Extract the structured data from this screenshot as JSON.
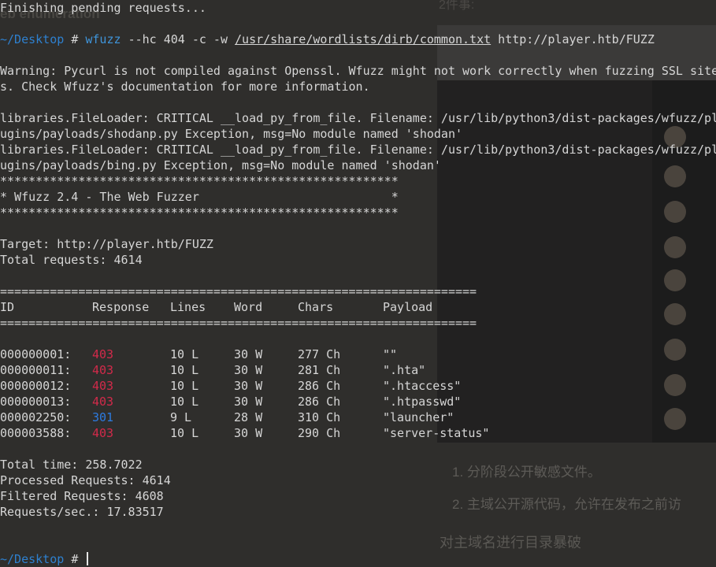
{
  "background": {
    "heading": "eb enumeration",
    "top_text": "2件事:",
    "list_items": [
      "1. 分阶段公开敏感文件。",
      "2. 主域公开源代码，允许在发布之前访"
    ],
    "bottom_text": "对主域名进行目录暴破"
  },
  "terminal": {
    "line_finishing": "Finishing pending requests...",
    "prompt_path": "~/Desktop",
    "prompt_symbol": "#",
    "command_name": "wfuzz",
    "command_args": "--hc 404 -c -w",
    "wordlist": "/usr/share/wordlists/dirb/common.txt",
    "url": "http://player.htb/FUZZ",
    "warning_1": "Warning: Pycurl is not compiled against Openssl. Wfuzz might not work correctly when fuzzing SSL site",
    "warning_2": "s. Check Wfuzz's documentation for more information.",
    "err1a": "libraries.FileLoader: CRITICAL __load_py_from_file. Filename: /usr/lib/python3/dist-packages/wfuzz/pl",
    "err1b": "ugins/payloads/shodanp.py Exception, msg=No module named 'shodan'",
    "err2a": "libraries.FileLoader: CRITICAL __load_py_from_file. Filename: /usr/lib/python3/dist-packages/wfuzz/pl",
    "err2b": "ugins/payloads/bing.py Exception, msg=No module named 'shodan'",
    "stars": "********************************************************",
    "banner": "* Wfuzz 2.4 - The Web Fuzzer                           *",
    "target": "Target: http://player.htb/FUZZ",
    "total_requests": "Total requests: 4614",
    "separator": "===================================================================",
    "headers": {
      "id": "ID",
      "response": "Response",
      "lines": "Lines",
      "word": "Word",
      "chars": "Chars",
      "payload": "Payload"
    },
    "rows": [
      {
        "id": "000000001:",
        "response": "403",
        "lines": "10 L",
        "word": "30 W",
        "chars": "277 Ch",
        "payload": "\"\""
      },
      {
        "id": "000000011:",
        "response": "403",
        "lines": "10 L",
        "word": "30 W",
        "chars": "281 Ch",
        "payload": "\".hta\""
      },
      {
        "id": "000000012:",
        "response": "403",
        "lines": "10 L",
        "word": "30 W",
        "chars": "286 Ch",
        "payload": "\".htaccess\""
      },
      {
        "id": "000000013:",
        "response": "403",
        "lines": "10 L",
        "word": "30 W",
        "chars": "286 Ch",
        "payload": "\".htpasswd\""
      },
      {
        "id": "000002250:",
        "response": "301",
        "lines": "9 L",
        "word": "28 W",
        "chars": "310 Ch",
        "payload": "\"launcher\""
      },
      {
        "id": "000003588:",
        "response": "403",
        "lines": "10 L",
        "word": "30 W",
        "chars": "290 Ch",
        "payload": "\"server-status\""
      }
    ],
    "total_time": "Total time: 258.7022",
    "processed": "Processed Requests: 4614",
    "filtered": "Filtered Requests: 4608",
    "rate": "Requests/sec.: 17.83517"
  },
  "colors": {
    "prompt": "#2e80cf",
    "status_403": "#d22a4a",
    "status_301": "#2d7be0",
    "text": "#d6d6d6",
    "background": "#2e2d2b"
  }
}
